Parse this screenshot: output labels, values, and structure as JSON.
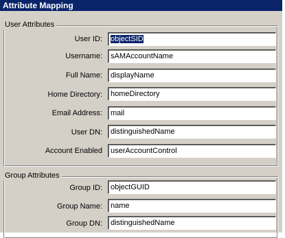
{
  "title": "Attribute Mapping",
  "user_attributes": {
    "legend": "User Attributes",
    "fields": [
      {
        "label": "User ID:",
        "value": "objectSID"
      },
      {
        "label": "Username:",
        "value": "sAMAccountName"
      },
      {
        "label": "Full Name:",
        "value": "displayName"
      },
      {
        "label": "Home Directory:",
        "value": "homeDirectory"
      },
      {
        "label": "Email Address:",
        "value": "mail"
      },
      {
        "label": "User DN:",
        "value": "distinguishedName"
      },
      {
        "label": "Account Enabled",
        "value": "userAccountControl"
      }
    ]
  },
  "group_attributes": {
    "legend": "Group Attributes",
    "fields": [
      {
        "label": "Group ID:",
        "value": "objectGUID"
      },
      {
        "label": "Group Name:",
        "value": "name"
      },
      {
        "label": "Group DN:",
        "value": "distinguishedName"
      }
    ]
  },
  "colors": {
    "title_bar": "#0a246a",
    "panel_background": "#d4d0c8",
    "field_background": "#ffffff",
    "selection": "#0a246a"
  }
}
